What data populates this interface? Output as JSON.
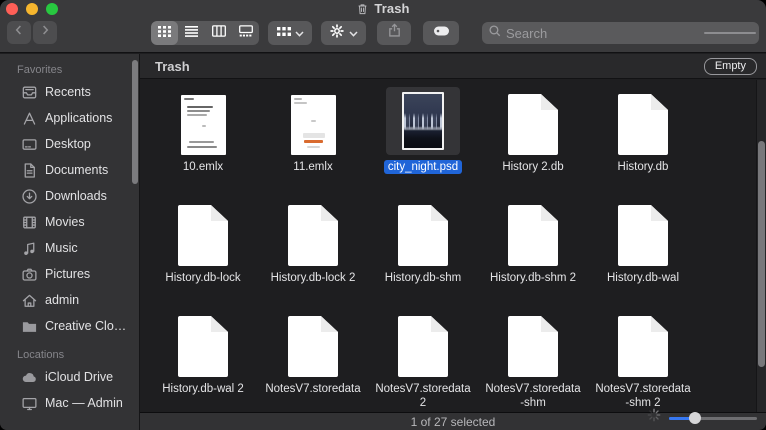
{
  "window": {
    "title": "Trash"
  },
  "toolbar": {
    "search_placeholder": "Search"
  },
  "sidebar": {
    "sections": [
      {
        "header": "Favorites",
        "items": [
          {
            "label": "Recents",
            "icon": "recents"
          },
          {
            "label": "Applications",
            "icon": "applications"
          },
          {
            "label": "Desktop",
            "icon": "desktop"
          },
          {
            "label": "Documents",
            "icon": "documents"
          },
          {
            "label": "Downloads",
            "icon": "downloads"
          },
          {
            "label": "Movies",
            "icon": "movies"
          },
          {
            "label": "Music",
            "icon": "music"
          },
          {
            "label": "Pictures",
            "icon": "pictures"
          },
          {
            "label": "admin",
            "icon": "home"
          },
          {
            "label": "Creative Clo…",
            "icon": "folder"
          }
        ]
      },
      {
        "header": "Locations",
        "items": [
          {
            "label": "iCloud Drive",
            "icon": "cloud"
          },
          {
            "label": "Mac — Admin",
            "icon": "display"
          }
        ]
      }
    ]
  },
  "content": {
    "header": {
      "title": "Trash",
      "empty_label": "Empty"
    },
    "files": [
      {
        "name": "10.emlx",
        "type": "emlx-a",
        "selected": false
      },
      {
        "name": "11.emlx",
        "type": "emlx-b",
        "selected": false
      },
      {
        "name": "city_night.psd",
        "type": "psd",
        "selected": true
      },
      {
        "name": "History 2.db",
        "type": "doc",
        "selected": false
      },
      {
        "name": "History.db",
        "type": "doc",
        "selected": false
      },
      {
        "name": "History.db-lock",
        "type": "doc",
        "selected": false
      },
      {
        "name": "History.db-lock 2",
        "type": "doc",
        "selected": false
      },
      {
        "name": "History.db-shm",
        "type": "doc",
        "selected": false
      },
      {
        "name": "History.db-shm 2",
        "type": "doc",
        "selected": false
      },
      {
        "name": "History.db-wal",
        "type": "doc",
        "selected": false
      },
      {
        "name": "History.db-wal 2",
        "type": "doc",
        "selected": false
      },
      {
        "name": "NotesV7.storedata",
        "type": "doc",
        "selected": false
      },
      {
        "name": "NotesV7.storedata 2",
        "type": "doc",
        "selected": false
      },
      {
        "name": "NotesV7.storedata-shm",
        "type": "doc",
        "selected": false
      },
      {
        "name": "NotesV7.storedata-shm 2",
        "type": "doc",
        "selected": false
      }
    ]
  },
  "statusbar": {
    "status": "1 of 27 selected"
  },
  "colors": {
    "selection_blue": "#2065d8",
    "slider_blue": "#3778f2",
    "traffic_red": "#ff5f57",
    "traffic_yellow": "#f6b62e",
    "traffic_green": "#28c840",
    "emlx_accent_orange": "#d96b2f"
  }
}
